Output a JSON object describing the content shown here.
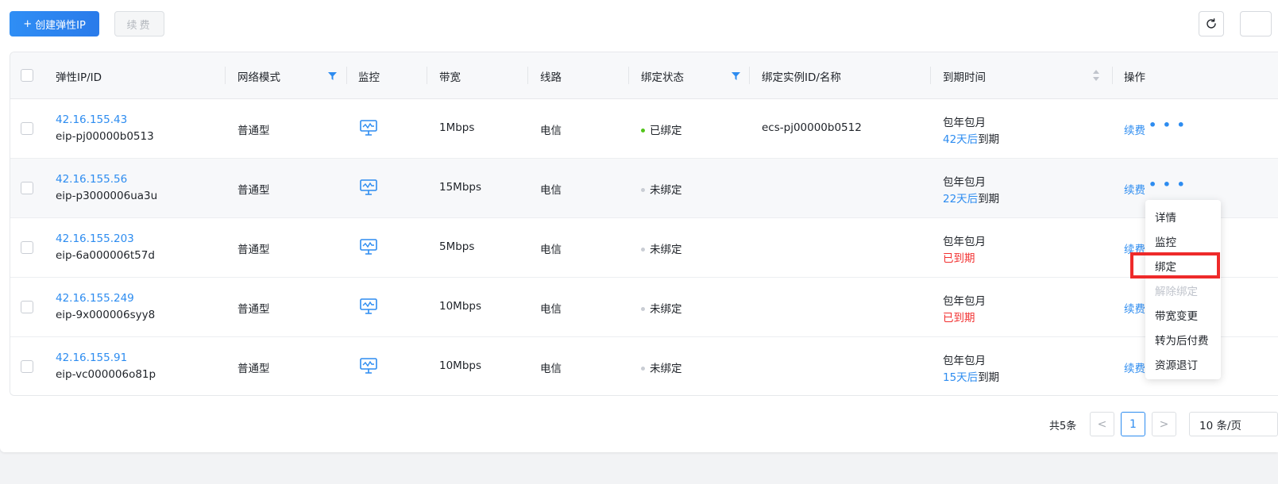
{
  "toolbar": {
    "create_label": "创建弹性IP",
    "create_plus": "+",
    "renew_label": "续费"
  },
  "columns": {
    "ip_id": "弹性IP/ID",
    "network_mode": "网络模式",
    "monitor": "监控",
    "bandwidth": "带宽",
    "line": "线路",
    "bind_status": "绑定状态",
    "bound_instance": "绑定实例ID/名称",
    "expire": "到期时间",
    "actions": "操作"
  },
  "rows": [
    {
      "ip": "42.16.155.43",
      "id": "eip-pj00000b0513",
      "mode": "普通型",
      "bandwidth": "1Mbps",
      "line": "电信",
      "status": "已绑定",
      "status_color": "#52c41a",
      "instance": "ecs-pj00000b0512",
      "billing": "包年包月",
      "expire_highlight": "42天后",
      "expire_rest": "到期",
      "expire_color": "#2d8cf0",
      "renew": "续费"
    },
    {
      "ip": "42.16.155.56",
      "id": "eip-p3000006ua3u",
      "mode": "普通型",
      "bandwidth": "15Mbps",
      "line": "电信",
      "status": "未绑定",
      "status_color": "#c9cdd4",
      "instance": "",
      "billing": "包年包月",
      "expire_highlight": "22天后",
      "expire_rest": "到期",
      "expire_color": "#2d8cf0",
      "renew": "续费"
    },
    {
      "ip": "42.16.155.203",
      "id": "eip-6a000006t57d",
      "mode": "普通型",
      "bandwidth": "5Mbps",
      "line": "电信",
      "status": "未绑定",
      "status_color": "#c9cdd4",
      "instance": "",
      "billing": "包年包月",
      "expire_highlight": "已到期",
      "expire_rest": "",
      "expire_color": "#f23030",
      "renew": "续费"
    },
    {
      "ip": "42.16.155.249",
      "id": "eip-9x000006syy8",
      "mode": "普通型",
      "bandwidth": "10Mbps",
      "line": "电信",
      "status": "未绑定",
      "status_color": "#c9cdd4",
      "instance": "",
      "billing": "包年包月",
      "expire_highlight": "已到期",
      "expire_rest": "",
      "expire_color": "#f23030",
      "renew": "续费"
    },
    {
      "ip": "42.16.155.91",
      "id": "eip-vc000006o81p",
      "mode": "普通型",
      "bandwidth": "10Mbps",
      "line": "电信",
      "status": "未绑定",
      "status_color": "#c9cdd4",
      "instance": "",
      "billing": "包年包月",
      "expire_highlight": "15天后",
      "expire_rest": "到期",
      "expire_color": "#2d8cf0",
      "renew": "续费"
    }
  ],
  "more_dots": "• • •",
  "dropdown": {
    "items": [
      "详情",
      "监控",
      "绑定",
      "解除绑定",
      "带宽变更",
      "转为后付费",
      "资源退订"
    ]
  },
  "pagination": {
    "total": "共5条",
    "prev": "<",
    "page": "1",
    "next": ">",
    "page_size": "10 条/页"
  },
  "colors": {
    "accent": "#2d8cf0",
    "expired": "#f23030",
    "bound": "#52c41a",
    "highlight_box": "#ee2a2a"
  }
}
